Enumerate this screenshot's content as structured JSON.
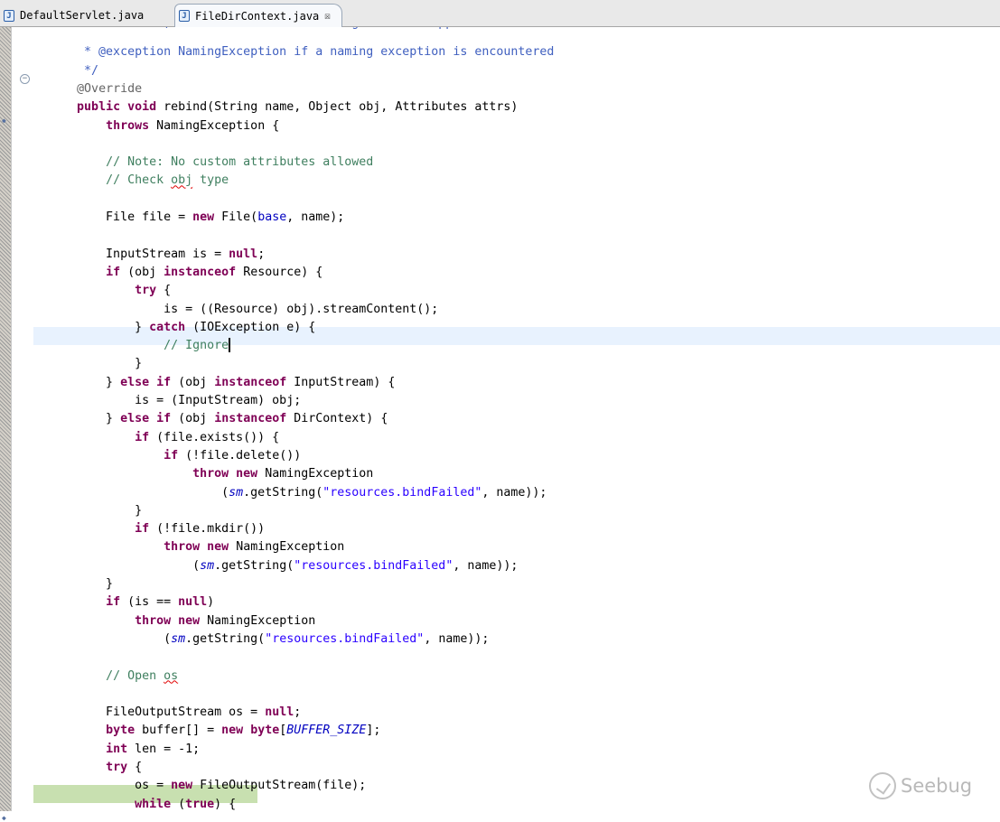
{
  "tabs": [
    {
      "label": "DefaultServlet.java",
      "icon": "java-file-icon"
    },
    {
      "label": "FileDirContext.java",
      "icon": "java-file-icon",
      "active": true,
      "close_glyph": "☒"
    }
  ],
  "editor": {
    "lines": [
      [
        {
          "t": "           ",
          "c": "jd"
        },
        {
          "t": "unbound; attributes of the binding are not supported",
          "c": "jd"
        }
      ],
      [
        {
          "t": "       * @exception NamingException if a naming exception is encountered",
          "c": "jd"
        }
      ],
      [
        {
          "t": "       */",
          "c": "jd"
        }
      ],
      [
        {
          "t": "      "
        },
        {
          "t": "@Override",
          "c": "ann"
        }
      ],
      [
        {
          "t": "      "
        },
        {
          "t": "public",
          "c": "kw"
        },
        {
          "t": " "
        },
        {
          "t": "void",
          "c": "kw"
        },
        {
          "t": " rebind(String name, Object obj, Attributes attrs)"
        }
      ],
      [
        {
          "t": "          "
        },
        {
          "t": "throws",
          "c": "kw"
        },
        {
          "t": " NamingException {"
        }
      ],
      [
        {
          "t": ""
        }
      ],
      [
        {
          "t": "          "
        },
        {
          "t": "// Note: No custom attributes allowed",
          "c": "cm"
        }
      ],
      [
        {
          "t": "          "
        },
        {
          "t": "// Check ",
          "c": "cm"
        },
        {
          "t": "obj",
          "c": "cm squig"
        },
        {
          "t": " type",
          "c": "cm"
        }
      ],
      [
        {
          "t": ""
        }
      ],
      [
        {
          "t": "          File file = "
        },
        {
          "t": "new",
          "c": "kw"
        },
        {
          "t": " File("
        },
        {
          "t": "base",
          "c": "fld"
        },
        {
          "t": ", name);"
        }
      ],
      [
        {
          "t": ""
        }
      ],
      [
        {
          "t": "          InputStream is = "
        },
        {
          "t": "null",
          "c": "kw"
        },
        {
          "t": ";"
        }
      ],
      [
        {
          "t": "          "
        },
        {
          "t": "if",
          "c": "kw"
        },
        {
          "t": " (obj "
        },
        {
          "t": "instanceof",
          "c": "kw"
        },
        {
          "t": " Resource) {"
        }
      ],
      [
        {
          "t": "              "
        },
        {
          "t": "try",
          "c": "kw"
        },
        {
          "t": " {"
        }
      ],
      [
        {
          "t": "                  is = ((Resource) obj).streamContent();"
        }
      ],
      [
        {
          "t": "              } "
        },
        {
          "t": "catch",
          "c": "kw"
        },
        {
          "t": " (IOException e) {"
        }
      ],
      [
        {
          "t": "                  "
        },
        {
          "t": "// Ignore",
          "c": "cm"
        },
        {
          "t": "",
          "caret": true
        }
      ],
      [
        {
          "t": "              }"
        }
      ],
      [
        {
          "t": "          } "
        },
        {
          "t": "else",
          "c": "kw"
        },
        {
          "t": " "
        },
        {
          "t": "if",
          "c": "kw"
        },
        {
          "t": " (obj "
        },
        {
          "t": "instanceof",
          "c": "kw"
        },
        {
          "t": " InputStream) {"
        }
      ],
      [
        {
          "t": "              is = (InputStream) obj;"
        }
      ],
      [
        {
          "t": "          } "
        },
        {
          "t": "else",
          "c": "kw"
        },
        {
          "t": " "
        },
        {
          "t": "if",
          "c": "kw"
        },
        {
          "t": " (obj "
        },
        {
          "t": "instanceof",
          "c": "kw"
        },
        {
          "t": " DirContext) {"
        }
      ],
      [
        {
          "t": "              "
        },
        {
          "t": "if",
          "c": "kw"
        },
        {
          "t": " (file.exists()) {"
        }
      ],
      [
        {
          "t": "                  "
        },
        {
          "t": "if",
          "c": "kw"
        },
        {
          "t": " (!file.delete())"
        }
      ],
      [
        {
          "t": "                      "
        },
        {
          "t": "throw",
          "c": "kw"
        },
        {
          "t": " "
        },
        {
          "t": "new",
          "c": "kw"
        },
        {
          "t": " NamingException"
        }
      ],
      [
        {
          "t": "                          ("
        },
        {
          "t": "sm",
          "c": "ital"
        },
        {
          "t": ".getString("
        },
        {
          "t": "\"resources.bindFailed\"",
          "c": "str"
        },
        {
          "t": ", name));"
        }
      ],
      [
        {
          "t": "              }"
        }
      ],
      [
        {
          "t": "              "
        },
        {
          "t": "if",
          "c": "kw"
        },
        {
          "t": " (!file.mkdir())"
        }
      ],
      [
        {
          "t": "                  "
        },
        {
          "t": "throw",
          "c": "kw"
        },
        {
          "t": " "
        },
        {
          "t": "new",
          "c": "kw"
        },
        {
          "t": " NamingException"
        }
      ],
      [
        {
          "t": "                      ("
        },
        {
          "t": "sm",
          "c": "ital"
        },
        {
          "t": ".getString("
        },
        {
          "t": "\"resources.bindFailed\"",
          "c": "str"
        },
        {
          "t": ", name));"
        }
      ],
      [
        {
          "t": "          }"
        }
      ],
      [
        {
          "t": "          "
        },
        {
          "t": "if",
          "c": "kw"
        },
        {
          "t": " (is == "
        },
        {
          "t": "null",
          "c": "kw"
        },
        {
          "t": ")"
        }
      ],
      [
        {
          "t": "              "
        },
        {
          "t": "throw",
          "c": "kw"
        },
        {
          "t": " "
        },
        {
          "t": "new",
          "c": "kw"
        },
        {
          "t": " NamingException"
        }
      ],
      [
        {
          "t": "                  ("
        },
        {
          "t": "sm",
          "c": "ital"
        },
        {
          "t": ".getString("
        },
        {
          "t": "\"resources.bindFailed\"",
          "c": "str"
        },
        {
          "t": ", name));"
        }
      ],
      [
        {
          "t": ""
        }
      ],
      [
        {
          "t": "          "
        },
        {
          "t": "// Open ",
          "c": "cm"
        },
        {
          "t": "os",
          "c": "cm squig"
        }
      ],
      [
        {
          "t": ""
        }
      ],
      [
        {
          "t": "          FileOutputStream os = "
        },
        {
          "t": "null",
          "c": "kw"
        },
        {
          "t": ";"
        }
      ],
      [
        {
          "t": "          "
        },
        {
          "t": "byte",
          "c": "kw"
        },
        {
          "t": " buffer[] = "
        },
        {
          "t": "new",
          "c": "kw"
        },
        {
          "t": " "
        },
        {
          "t": "byte",
          "c": "kw"
        },
        {
          "t": "["
        },
        {
          "t": "BUFFER_SIZE",
          "c": "ital"
        },
        {
          "t": "];"
        }
      ],
      [
        {
          "t": "          "
        },
        {
          "t": "int",
          "c": "kw"
        },
        {
          "t": " len = -1;"
        }
      ],
      [
        {
          "t": "          "
        },
        {
          "t": "try",
          "c": "kw"
        },
        {
          "t": " {"
        }
      ],
      [
        {
          "t": "              os = "
        },
        {
          "t": "new",
          "c": "kw"
        },
        {
          "t": " FileOutputStream(file);"
        }
      ],
      [
        {
          "t": "              "
        },
        {
          "t": "while",
          "c": "kw"
        },
        {
          "t": " ("
        },
        {
          "t": "true",
          "c": "kw"
        },
        {
          "t": ") {"
        }
      ]
    ],
    "current_line_index": 17,
    "debug_line_index": 42
  },
  "watermark": {
    "text": "Seebug"
  }
}
